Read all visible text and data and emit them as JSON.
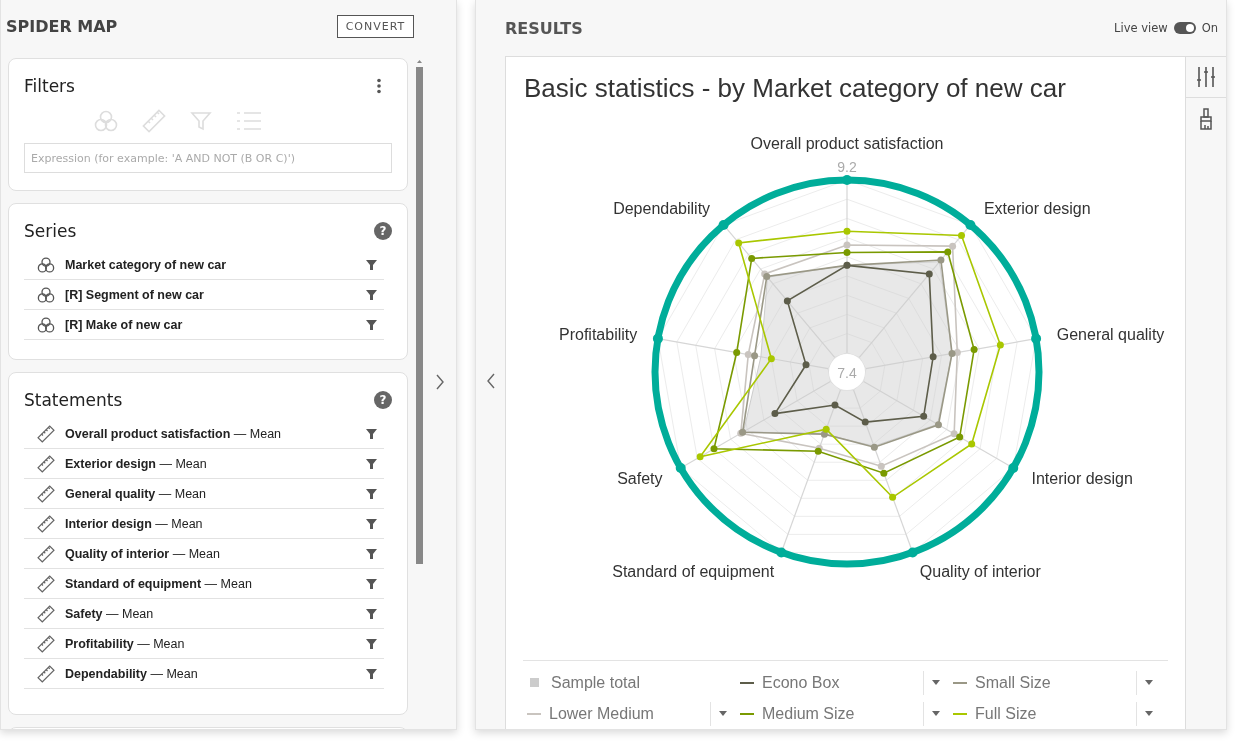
{
  "left_panel": {
    "title": "SPIDER MAP",
    "convert_button": "CONVERT",
    "filters": {
      "title": "Filters",
      "expression_placeholder": "Expression (for example: 'A AND NOT (B OR C)')"
    },
    "series": {
      "title": "Series",
      "help": "?",
      "items": [
        {
          "label": "Market category of new car"
        },
        {
          "label": "[R] Segment of new car"
        },
        {
          "label": "[R] Make of new car"
        }
      ]
    },
    "statements": {
      "title": "Statements",
      "help": "?",
      "items": [
        {
          "label": "**Overall product satisfaction** — Mean"
        },
        {
          "label": "**Exterior design** — Mean"
        },
        {
          "label": "**General quality** — Mean"
        },
        {
          "label": "**Interior design** — Mean"
        },
        {
          "label": "**Quality of interior** — Mean"
        },
        {
          "label": "**Standard of equipment** — Mean"
        },
        {
          "label": "**Safety** — Mean"
        },
        {
          "label": "**Profitability** — Mean"
        },
        {
          "label": "**Dependability** — Mean"
        }
      ]
    }
  },
  "results": {
    "title": "RESULTS",
    "live_view": {
      "label": "Live view",
      "on": true,
      "state_text": "On"
    },
    "chart_title": "Basic statistics - by Market category of new car",
    "spider_chart": {
      "axes": [
        "Overall product satisfaction",
        "Dependability",
        "Exterior design",
        "Profitability",
        "General quality",
        "Safety",
        "Interior design",
        "Standard of equipment",
        "Quality of interior"
      ],
      "outer_tick": "9.2",
      "center_tick": "7.4",
      "legend": [
        {
          "name": "Sample total",
          "kind": "area",
          "color": "#cccccc"
        },
        {
          "name": "Econo Box",
          "kind": "line",
          "color": "#5d5d4a"
        },
        {
          "name": "Small Size",
          "kind": "line",
          "color": "#9a9886"
        },
        {
          "name": "Lower Medium",
          "kind": "line",
          "color": "#c9c4bf"
        },
        {
          "name": "Medium Size",
          "kind": "line",
          "color": "#7a9a01"
        },
        {
          "name": "Full Size",
          "kind": "line",
          "color": "#a9c700"
        }
      ]
    }
  }
}
